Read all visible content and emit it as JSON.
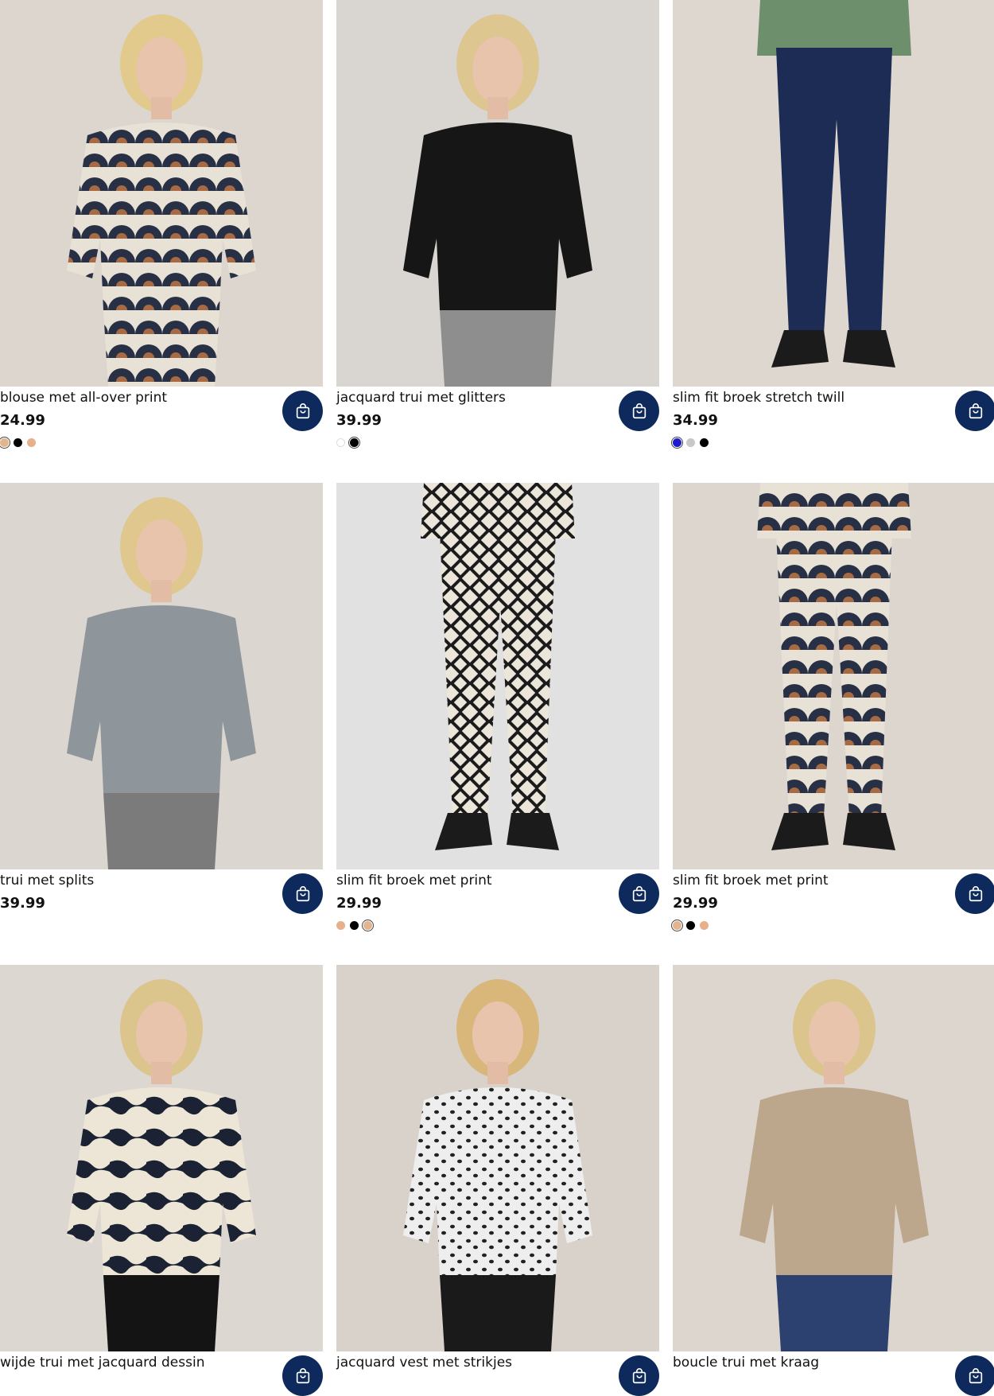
{
  "products": [
    {
      "title": "blouse met all-over print",
      "price": "24.99",
      "swatches": [
        "#e3b58e",
        "#000000",
        "#e6b08a"
      ],
      "selected": 0,
      "bg": "#dcd6cf",
      "garment": "print-blouse"
    },
    {
      "title": "jacquard trui met glitters",
      "price": "39.99",
      "swatches": [
        "#ffffff",
        "#000000"
      ],
      "selected": 1,
      "bg": "#d9d5d0",
      "garment": "black-sweater"
    },
    {
      "title": "slim fit broek stretch twill",
      "price": "34.99",
      "swatches": [
        "#1c1ccc",
        "#c8c8c8",
        "#000000"
      ],
      "selected": 0,
      "bg": "#ddd7d0",
      "garment": "navy-pants"
    },
    {
      "title": "trui met splits",
      "price": "39.99",
      "swatches": [],
      "selected": -1,
      "bg": "#dcd6d0",
      "garment": "grey-sweater"
    },
    {
      "title": "slim fit broek met print",
      "price": "29.99",
      "swatches": [
        "#e6b08a",
        "#000000",
        "#e3b58e"
      ],
      "selected": 2,
      "bg": "#e1e1e1",
      "garment": "diamond-pants"
    },
    {
      "title": "slim fit broek met print",
      "price": "29.99",
      "swatches": [
        "#e3b58e",
        "#000000",
        "#e6b08a"
      ],
      "selected": 0,
      "bg": "#dcd6cf",
      "garment": "fan-pants"
    },
    {
      "title": "wijde trui met jacquard dessin",
      "price": "",
      "swatches": [],
      "selected": -1,
      "bg": "#dcd7d1",
      "garment": "animal-sweater"
    },
    {
      "title": "jacquard vest met strikjes",
      "price": "",
      "swatches": [],
      "selected": -1,
      "bg": "#d8d2cb",
      "garment": "spotted-cardigan"
    },
    {
      "title": "boucle trui met kraag",
      "price": "",
      "swatches": [],
      "selected": -1,
      "bg": "#ddd6cf",
      "garment": "beige-sweater"
    }
  ],
  "cart_icon": "shopping-bag-icon",
  "accent": "#0e2a5c"
}
